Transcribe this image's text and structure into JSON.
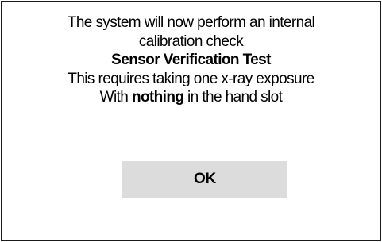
{
  "dialog": {
    "line1": "The system will now perform an internal",
    "line2": "calibration check",
    "test_name": "Sensor Verification Test",
    "line4": "This requires taking one x-ray exposure",
    "line5_prefix": "With ",
    "line5_emphasis": "nothing",
    "line5_suffix": " in the hand slot",
    "ok_label": "OK"
  },
  "colors": {
    "background": "#ffffff",
    "border": "#1a1a1a",
    "button_background": "#dcdcdc",
    "text": "#000000"
  }
}
